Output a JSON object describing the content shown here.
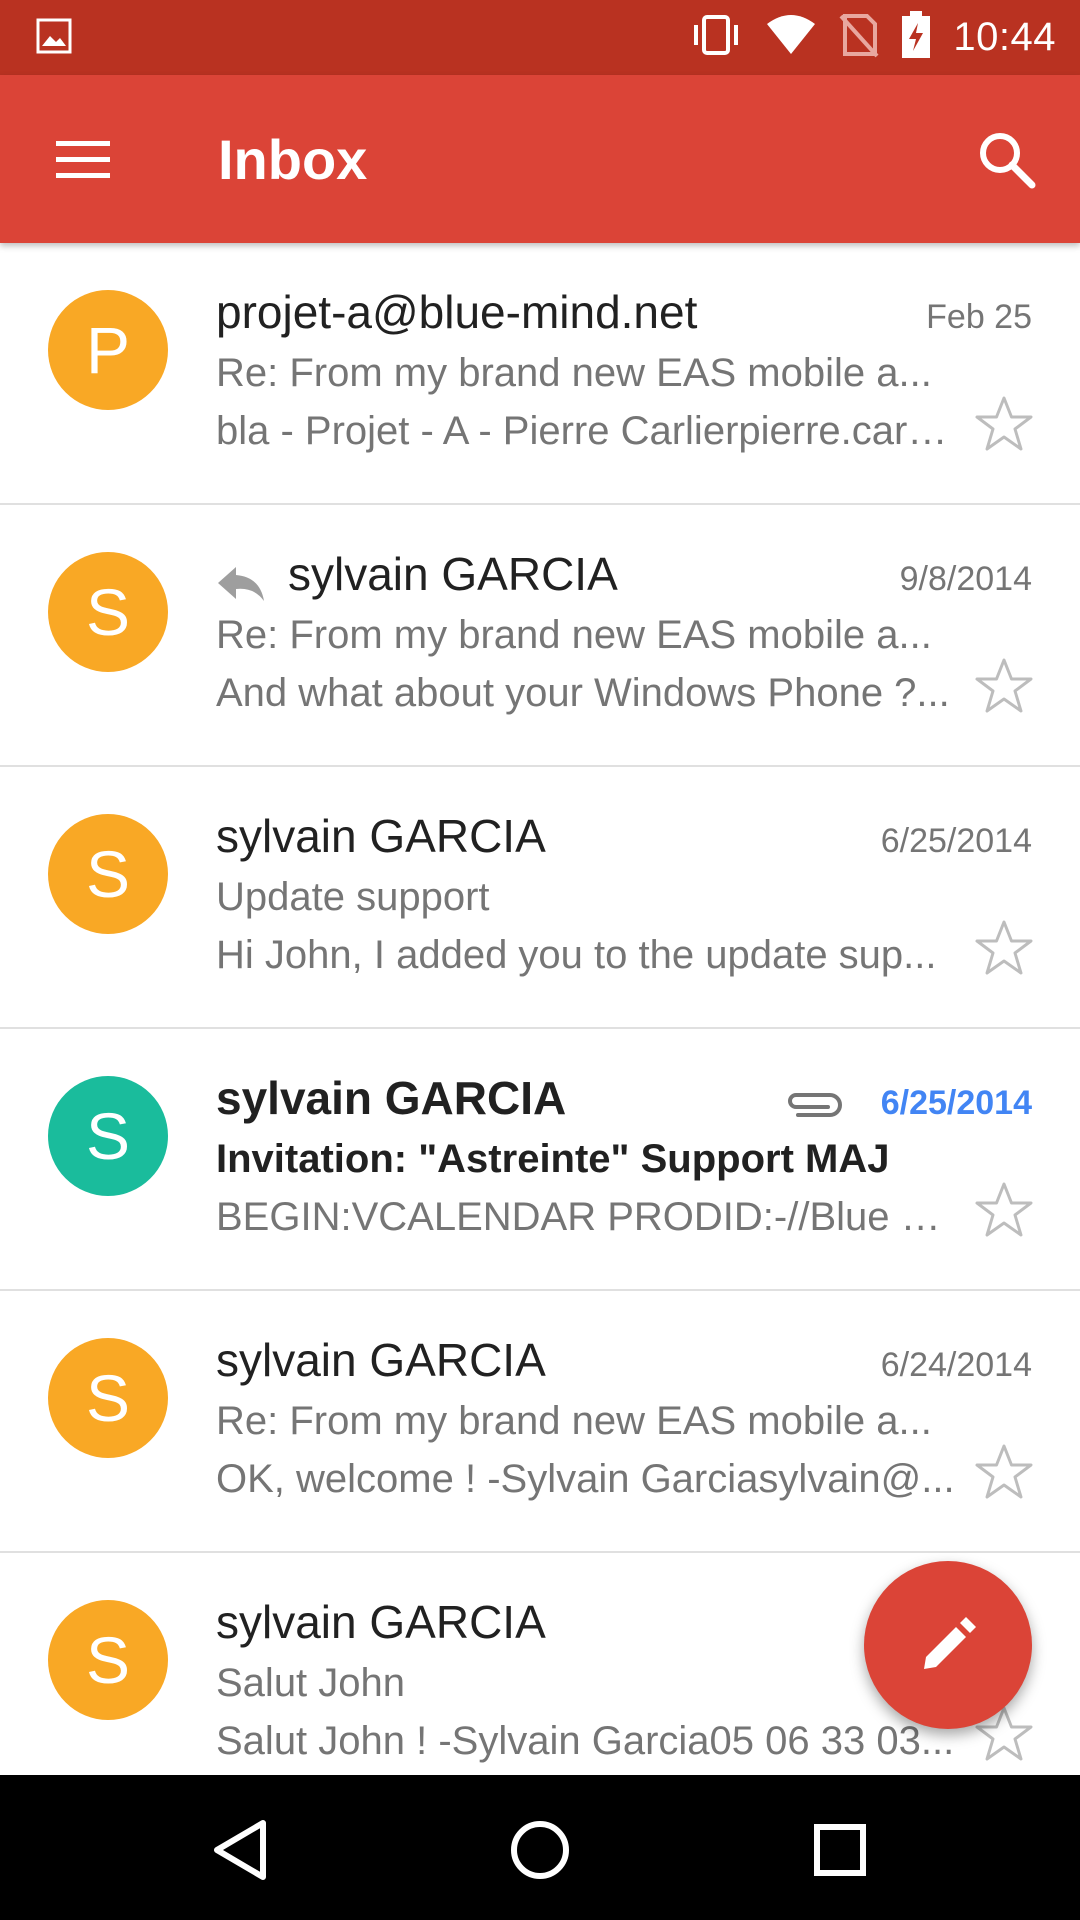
{
  "status_bar": {
    "time": "10:44",
    "icons": [
      "image-icon",
      "vibrate-icon",
      "wifi-icon",
      "no-sim-icon",
      "battery-charging-icon"
    ]
  },
  "app_bar": {
    "title": "Inbox",
    "menu_icon": "hamburger-menu-icon",
    "search_icon": "search-icon"
  },
  "colors": {
    "status_bar": "#b93221",
    "app_bar": "#db4437",
    "avatar_orange": "#f9a825",
    "avatar_teal": "#1abc9c",
    "unread_date": "#4285f4",
    "fab": "#db4437"
  },
  "emails": [
    {
      "avatar_letter": "P",
      "avatar_color": "#f9a825",
      "sender": "projet-a@blue-mind.net",
      "date": "Feb 25",
      "subject": "Re: From my brand new EAS mobile a...",
      "snippet": "bla - Projet - A - Pierre Carlierpierre.carli...",
      "unread": false,
      "replied": false,
      "attachment": false,
      "starred": false
    },
    {
      "avatar_letter": "S",
      "avatar_color": "#f9a825",
      "sender": "sylvain GARCIA",
      "date": "9/8/2014",
      "subject": "Re: From my brand new EAS mobile a...",
      "snippet": "And what about your Windows Phone ?...",
      "unread": false,
      "replied": true,
      "attachment": false,
      "starred": false
    },
    {
      "avatar_letter": "S",
      "avatar_color": "#f9a825",
      "sender": "sylvain GARCIA",
      "date": "6/25/2014",
      "subject": "Update support",
      "snippet": "Hi John, I added you to the update sup...",
      "unread": false,
      "replied": false,
      "attachment": false,
      "starred": false
    },
    {
      "avatar_letter": "S",
      "avatar_color": "#1abc9c",
      "sender": "sylvain GARCIA",
      "date": "6/25/2014",
      "subject": "Invitation: \"Astreinte\" Support MAJ",
      "snippet": "BEGIN:VCALENDAR PRODID:-//Blue Mi...",
      "unread": true,
      "replied": false,
      "attachment": true,
      "starred": false
    },
    {
      "avatar_letter": "S",
      "avatar_color": "#f9a825",
      "sender": "sylvain GARCIA",
      "date": "6/24/2014",
      "subject": "Re: From my brand new EAS mobile a...",
      "snippet": "OK, welcome ! -Sylvain Garciasylvain@...",
      "unread": false,
      "replied": false,
      "attachment": false,
      "starred": false
    },
    {
      "avatar_letter": "S",
      "avatar_color": "#f9a825",
      "sender": "sylvain GARCIA",
      "date": "",
      "subject": "Salut John",
      "snippet": "Salut John ! -Sylvain Garcia05 06 33 03...",
      "unread": false,
      "replied": false,
      "attachment": false,
      "starred": false
    }
  ],
  "fab": {
    "icon": "pencil-compose-icon"
  },
  "nav_bar": {
    "icons": [
      "back-triangle-icon",
      "home-circle-icon",
      "recents-square-icon"
    ]
  }
}
